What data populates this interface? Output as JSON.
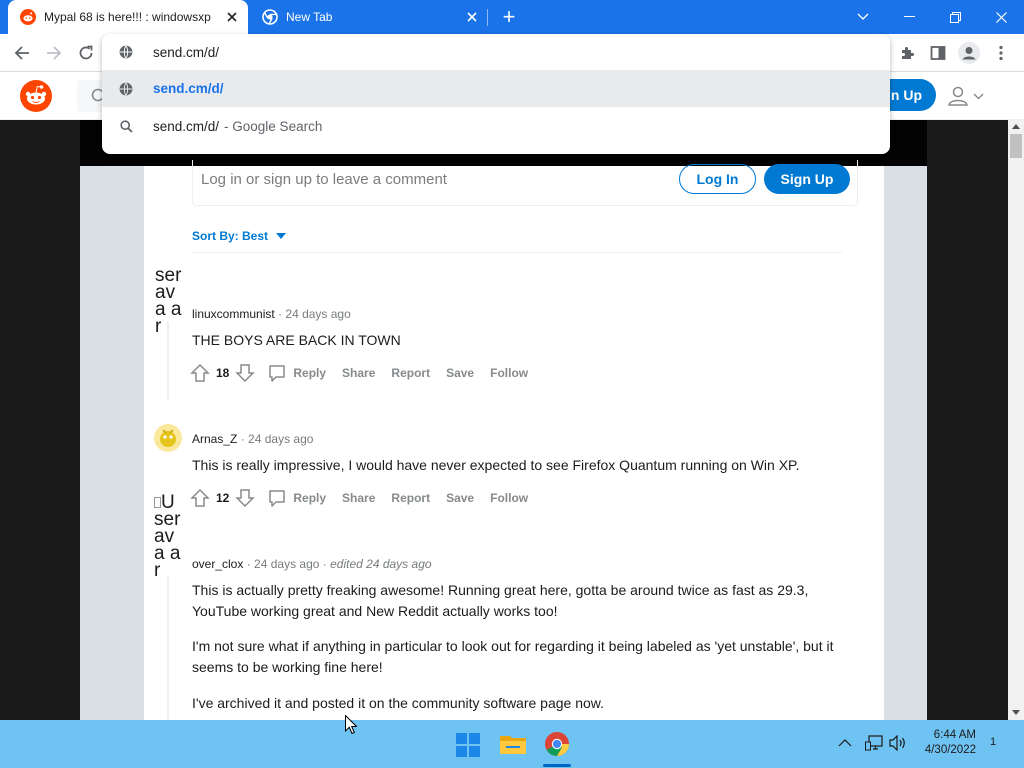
{
  "browser": {
    "tabs": [
      {
        "title": "Mypal 68 is here!!! : windowsxp",
        "active": true
      },
      {
        "title": "New Tab",
        "active": false
      }
    ],
    "new_tab": "+",
    "address": "send.cm/d/",
    "suggestions": [
      {
        "text": "send.cm/d/",
        "kind": "url"
      },
      {
        "text": "send.cm/d/",
        "suffix": "- Google Search",
        "kind": "search"
      }
    ]
  },
  "reddit_header": {
    "signup_label": "n Up"
  },
  "comment_box": {
    "placeholder": "Log in or sign up to leave a comment",
    "login_label": "Log In",
    "signup_label": "Sign Up"
  },
  "sort": {
    "label": "Sort By: Best"
  },
  "comments": [
    {
      "author": "linuxcommunist",
      "time": "24 days ago",
      "body": "THE BOYS ARE BACK IN TOWN",
      "score": "18",
      "avatar_alt": "ser ava ar"
    },
    {
      "author": "Arnas_Z",
      "time": "24 days ago",
      "body": "This is really impressive, I would have never expected to see Firefox Quantum running on Win XP.",
      "score": "12"
    },
    {
      "author": "over_clox",
      "time": "24 days ago",
      "edited": "edited 24 days ago",
      "avatar_alt": "U ser ava ar",
      "paragraphs": [
        "This is actually pretty freaking awesome! Running great here, gotta be around twice as fast as 29.3, YouTube working great and New Reddit actually works too!",
        "I'm not sure what if anything in particular to look out for regarding it being labeled as 'yet unstable', but it seems to be working fine here!",
        "I've archived it and posted it on the community software page now."
      ]
    }
  ],
  "actions": {
    "reply": "Reply",
    "share": "Share",
    "report": "Report",
    "save": "Save",
    "follow": "Follow"
  },
  "taskbar": {
    "time": "6:44 AM",
    "date": "4/30/2022",
    "notification_count": "1"
  },
  "colors": {
    "chrome_blue": "#1a73e8",
    "reddit_blue": "#0079d3",
    "reddit_orange": "#ff4500",
    "taskbar": "#6fc3f2"
  }
}
